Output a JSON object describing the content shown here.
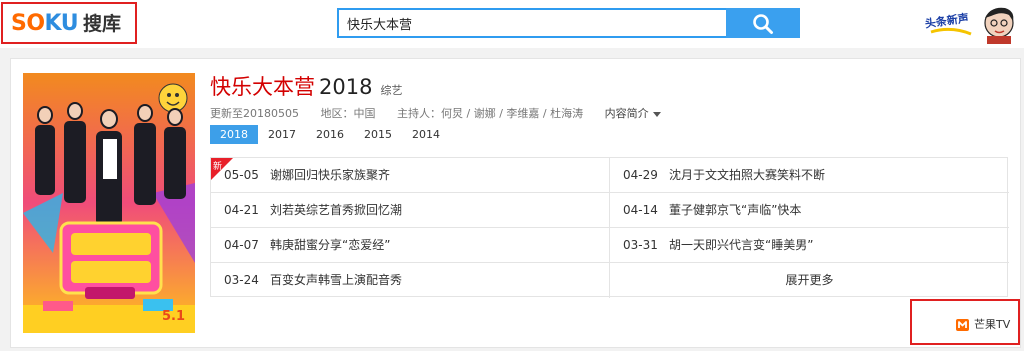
{
  "header": {
    "logo_en_so": "SO",
    "logo_en_ku": "KU",
    "logo_cn": "搜库",
    "search": {
      "value": "快乐大本营",
      "icon": "search-icon"
    },
    "user_art_icon": "user-avatar-art"
  },
  "show": {
    "title": "快乐大本营",
    "year": "2018",
    "category": "综艺",
    "updated": "更新至20180505",
    "region": "地区：中国",
    "hosts": "主持人：何炅 / 谢娜 / 李维嘉 / 杜海涛",
    "intro_label": "内容简介",
    "poster_badge": "5.1"
  },
  "year_tabs": [
    {
      "label": "2018",
      "active": true
    },
    {
      "label": "2017",
      "active": false
    },
    {
      "label": "2016",
      "active": false
    },
    {
      "label": "2015",
      "active": false
    },
    {
      "label": "2014",
      "active": false
    }
  ],
  "episodes": [
    {
      "date": "05-05",
      "title": "谢娜回归快乐家族聚齐"
    },
    {
      "date": "04-29",
      "title": "沈月于文文拍照大赛笑料不断"
    },
    {
      "date": "04-21",
      "title": "刘若英综艺首秀掀回忆潮"
    },
    {
      "date": "04-14",
      "title": "董子健郭京飞“声临”快本"
    },
    {
      "date": "04-07",
      "title": "韩庚甜蜜分享“恋爱经”"
    },
    {
      "date": "03-31",
      "title": "胡一天即兴代言变“睡美男”"
    },
    {
      "date": "03-24",
      "title": "百变女声韩雪上演配音秀"
    }
  ],
  "new_tag": "新",
  "more_label": "展开更多",
  "source": {
    "label": "芒果TV",
    "icon": "mango-tv-icon"
  },
  "colors": {
    "accent_blue": "#3aa0ef",
    "title_red": "#d30000",
    "highlight_box": "#e02020",
    "logo_orange": "#ff6a00",
    "logo_blue": "#2e8ddf"
  }
}
